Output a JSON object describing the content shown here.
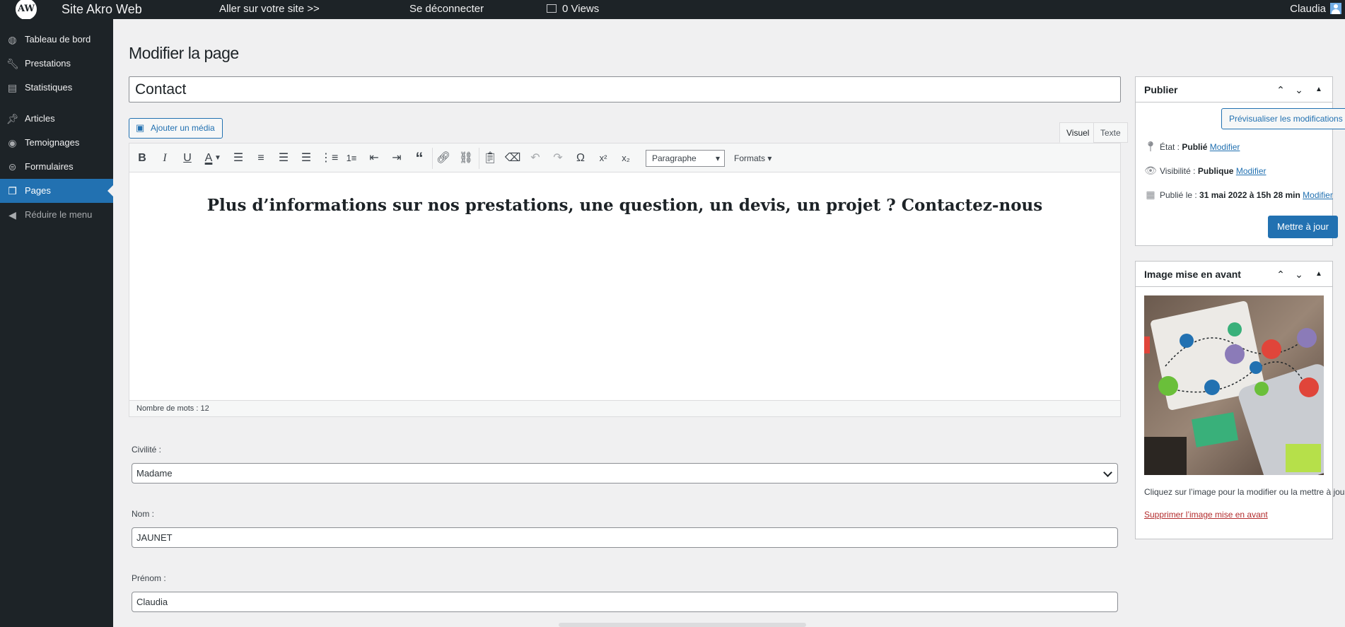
{
  "adminbar": {
    "logo_text": "AW",
    "site_name": "Site Akro Web",
    "visit_site": "Aller sur votre site >>",
    "logout": "Se déconnecter",
    "views": "0 Views",
    "user": "Claudia"
  },
  "sidebar": {
    "items": [
      {
        "label": "Tableau de bord",
        "icon": "dashboard-icon"
      },
      {
        "label": "Prestations",
        "icon": "wrench-icon"
      },
      {
        "label": "Statistiques",
        "icon": "chart-icon"
      },
      {
        "label": "Articles",
        "icon": "pin-icon"
      },
      {
        "label": "Temoignages",
        "icon": "testimonial-icon"
      },
      {
        "label": "Formulaires",
        "icon": "form-icon"
      },
      {
        "label": "Pages",
        "icon": "pages-icon",
        "current": true
      },
      {
        "label": "Réduire le menu",
        "icon": "collapse-icon"
      }
    ]
  },
  "main": {
    "heading": "Modifier la page",
    "title_value": "Contact",
    "add_media": "Ajouter un média",
    "tabs": {
      "visual": "Visuel",
      "text": "Texte"
    },
    "toolbar": {
      "format_select": "Paragraphe",
      "formats_menu": "Formats ▾"
    },
    "content_heading": "Plus d’informations sur nos prestations, une question, un devis, un projet ? Contactez-nous",
    "word_count": "Nombre de mots : 12",
    "fields": {
      "civilite_label": "Civilité :",
      "civilite_value": "Madame",
      "nom_label": "Nom :",
      "nom_value": "JAUNET",
      "prenom_label": "Prénom :",
      "prenom_value": "Claudia"
    }
  },
  "publish": {
    "title": "Publier",
    "preview": "Prévisualiser les modifications",
    "status_label": "État : ",
    "status_value": "Publié",
    "visibility_label": "Visibilité : ",
    "visibility_value": "Publique",
    "published_label": "Publié le : ",
    "published_value": "31 mai 2022 à 15h 28 min",
    "modify": "Modifier",
    "update": "Mettre à jour"
  },
  "featured": {
    "title": "Image mise en avant",
    "note": "Cliquez sur l’image pour la modifier ou la mettre à jour.",
    "remove": "Supprimer l’image mise en avant"
  },
  "colors": {
    "accent": "#2271b1",
    "sidebar_bg": "#1d2327",
    "danger": "#b32d2e"
  }
}
